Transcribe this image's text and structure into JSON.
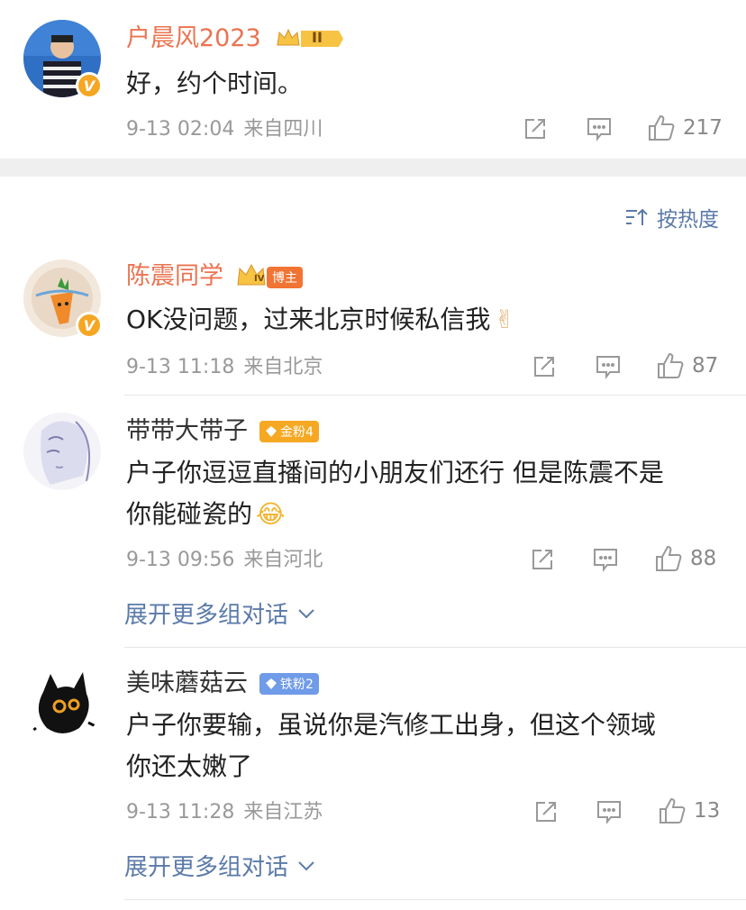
{
  "comments": [
    {
      "name": "户晨风2023",
      "level_badge": "II",
      "verified": "V",
      "text": "好，约个时间。",
      "time": "9-13 02:04",
      "location": "来自四川",
      "likes": "217"
    },
    {
      "name": "陈震同学",
      "badge": "博主",
      "crown_level": "IV",
      "verified": "V",
      "text": "OK没问题，过来北京时候私信我",
      "emoji": "✌",
      "time": "9-13 11:18",
      "location": "来自北京",
      "likes": "87"
    },
    {
      "name": "带带大带子",
      "badge": "金粉4",
      "text_line1": "户子你逗逗直播间的小朋友们还行 但是陈震不是",
      "text_line2": "你能碰瓷的",
      "emoji": "😂",
      "time": "9-13 09:56",
      "location": "来自河北",
      "likes": "88",
      "expand": "展开更多组对话"
    },
    {
      "name": "美味蘑菇云",
      "badge": "铁粉2",
      "text_line1": "户子你要输，虽说你是汽修工出身，但这个领域",
      "text_line2": "你还太嫩了",
      "time": "9-13 11:28",
      "location": "来自江苏",
      "likes": "13",
      "expand": "展开更多组对话"
    }
  ],
  "sort_label": "按热度",
  "colors": {
    "name_orange": "#eb7350",
    "link_blue": "#5b7aa8",
    "meta_gray": "#999999",
    "gap_gray": "#efefef"
  }
}
